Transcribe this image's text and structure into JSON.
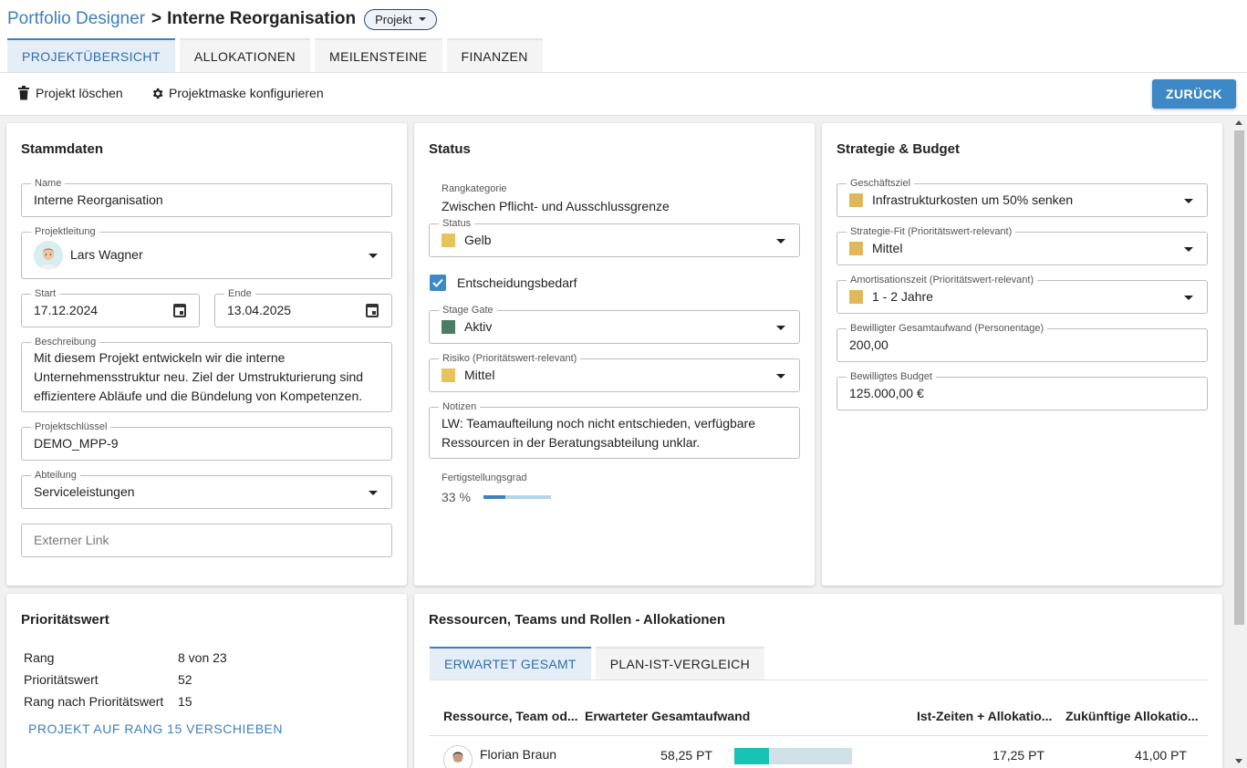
{
  "header": {
    "app_name": "Portfolio Designer",
    "separator": ">",
    "project_title": "Interne Reorganisation",
    "type_chip": "Projekt"
  },
  "tabs": [
    {
      "label": "PROJEKTÜBERSICHT",
      "active": true
    },
    {
      "label": "ALLOKATIONEN",
      "active": false
    },
    {
      "label": "MEILENSTEINE",
      "active": false
    },
    {
      "label": "FINANZEN",
      "active": false
    }
  ],
  "toolbar": {
    "delete_label": "Projekt löschen",
    "configure_label": "Projektmaske konfigurieren",
    "back_label": "ZURÜCK",
    "delete_icon": "trash-icon",
    "configure_icon": "gear-icon"
  },
  "stammdaten": {
    "title": "Stammdaten",
    "name_label": "Name",
    "name_value": "Interne Reorganisation",
    "lead_label": "Projektleitung",
    "lead_value": "Lars Wagner",
    "start_label": "Start",
    "start_value": "17.12.2024",
    "end_label": "Ende",
    "end_value": "13.04.2025",
    "desc_label": "Beschreibung",
    "desc_lines": [
      "Mit diesem Projekt entwickeln wir die interne",
      "Unternehmensstruktur neu. Ziel der Umstrukturierung sind",
      "effizientere Abläufe und die Bündelung von Kompetenzen."
    ],
    "key_label": "Projektschlüssel",
    "key_value": "DEMO_MPP-9",
    "dept_label": "Abteilung",
    "dept_value": "Serviceleistungen",
    "link_placeholder": "Externer Link"
  },
  "status": {
    "title": "Status",
    "rank_cat_label": "Rangkategorie",
    "rank_cat_value": "Zwischen Pflicht- und Ausschlussgrenze",
    "status_label": "Status",
    "status_value": "Gelb",
    "status_color": "#e6c35c",
    "decision_label": "Entscheidungsbedarf",
    "decision_checked": true,
    "gate_label": "Stage Gate",
    "gate_value": "Aktiv",
    "gate_color": "#4a7d63",
    "risk_label": "Risiko (Prioritätswert-relevant)",
    "risk_value": "Mittel",
    "risk_color": "#e6c35c",
    "notes_label": "Notizen",
    "notes_lines": [
      "LW: Teamaufteilung noch nicht entschieden, verfügbare",
      "Ressourcen in der Beratungsabteilung unklar."
    ],
    "progress_label": "Fertigstellungsgrad",
    "progress_text": "33 %",
    "progress_fraction": 0.33
  },
  "strategy": {
    "title": "Strategie & Budget",
    "goal_label": "Geschäftsziel",
    "goal_value": "Infrastrukturkosten um 50% senken",
    "fit_label": "Strategie-Fit (Prioritätswert-relevant)",
    "fit_value": "Mittel",
    "amort_label": "Amortisationszeit (Prioritätswert-relevant)",
    "amort_value": "1 - 2 Jahre",
    "effort_label": "Bewilligter Gesamtaufwand (Personentage)",
    "effort_value": "200,00",
    "budget_label": "Bewilligtes Budget",
    "budget_value": "125.000,00 €",
    "swatch_color": "#e0b85c"
  },
  "priority": {
    "title": "Prioritätswert",
    "rows": [
      {
        "label": "Rang",
        "value": "8 von 23"
      },
      {
        "label": "Prioritätswert",
        "value": "52"
      },
      {
        "label": "Rang nach Prioritätswert",
        "value": "15"
      }
    ],
    "move_button": "PROJEKT AUF RANG 15 VERSCHIEBEN"
  },
  "allocations": {
    "title": "Ressourcen, Teams und Rollen - Allokationen",
    "subtabs": [
      {
        "label": "ERWARTET GESAMT",
        "active": true
      },
      {
        "label": "PLAN-IST-VERGLEICH",
        "active": false
      }
    ],
    "columns": [
      "Ressource, Team od...",
      "Erwarteter Gesamtaufwand",
      "Ist-Zeiten + Allokatio...",
      "Zukünftige Allokatio..."
    ],
    "rows": [
      {
        "name": "Florian Braun",
        "expected": "58,25 PT",
        "actual": "17,25 PT",
        "future": "41,00 PT",
        "actual_fraction": 0.296
      }
    ]
  }
}
